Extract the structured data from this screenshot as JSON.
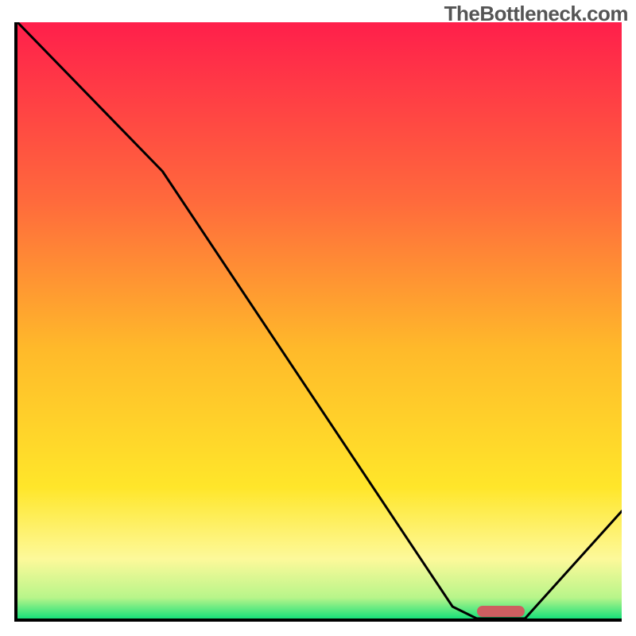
{
  "watermark": "TheBottleneck.com",
  "chart_data": {
    "type": "line",
    "title": "",
    "xlabel": "",
    "ylabel": "",
    "x_range": [
      0,
      100
    ],
    "y_range": [
      0,
      100
    ],
    "curve_points": [
      {
        "x": 0,
        "y": 100
      },
      {
        "x": 24,
        "y": 75
      },
      {
        "x": 72,
        "y": 2
      },
      {
        "x": 76,
        "y": 0
      },
      {
        "x": 84,
        "y": 0
      },
      {
        "x": 100,
        "y": 18
      }
    ],
    "optimal_zone": {
      "x_start": 76,
      "x_end": 84,
      "y": 0.5
    },
    "gradient_stops": [
      {
        "offset": 0.0,
        "color": "#ff1f4b"
      },
      {
        "offset": 0.3,
        "color": "#ff6a3c"
      },
      {
        "offset": 0.55,
        "color": "#ffba2a"
      },
      {
        "offset": 0.78,
        "color": "#ffe62a"
      },
      {
        "offset": 0.9,
        "color": "#fdf99a"
      },
      {
        "offset": 0.965,
        "color": "#b8f58a"
      },
      {
        "offset": 1.0,
        "color": "#18e07a"
      }
    ],
    "marker_color": "#cd5e60",
    "curve_color": "#000000"
  }
}
